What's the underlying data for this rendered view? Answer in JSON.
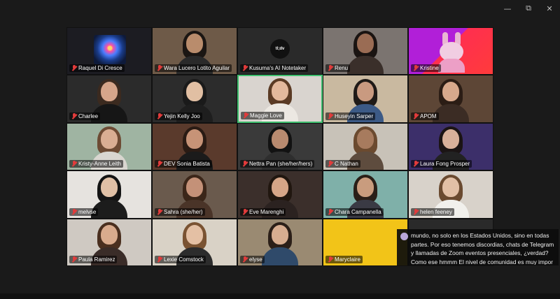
{
  "window": {
    "minimize_icon": "minimize-icon",
    "restore_icon": "restore-icon",
    "close_icon": "close-icon",
    "minimize_glyph": "—",
    "restore_glyph": "⧉",
    "close_glyph": "✕"
  },
  "participants": [
    {
      "name": "Raquel Di Cresce",
      "bg": "#1c1c22",
      "kind": "avatar-art"
    },
    {
      "name": "Wara Lucero Lotito Aguilar",
      "bg": "#6e5a48",
      "kind": "person",
      "skin": "#b98c6c",
      "hair": "#1b1613",
      "shirt": "#2a2a2a"
    },
    {
      "name": "Kusuma's AI Notetaker",
      "bg": "#2a2a2a",
      "kind": "logo",
      "logo_text": "tl;dv"
    },
    {
      "name": "Renu",
      "bg": "#7b7470",
      "kind": "person",
      "skin": "#9a6c54",
      "hair": "#1a1412",
      "shirt": "#3a2f2a"
    },
    {
      "name": "Kristine",
      "bg": "#a21fd6",
      "kind": "avatar-bunny"
    },
    {
      "name": "Charlee",
      "bg": "#2b2b2b",
      "kind": "person",
      "skin": "#d6a58a",
      "hair": "#3b2a1f",
      "shirt": "#161616"
    },
    {
      "name": "Yejin Kelly Joo",
      "bg": "#2c2c2c",
      "kind": "person",
      "skin": "#e1bfa3",
      "hair": "#1a1a1a",
      "shirt": "#1e1e1e"
    },
    {
      "name": "Maggie Love",
      "bg": "#d9d4cf",
      "kind": "person",
      "skin": "#e2b89c",
      "hair": "#5a3a24",
      "shirt": "#ece8e2",
      "active": true
    },
    {
      "name": "Huseyin Sarper",
      "bg": "#c9b9a0",
      "kind": "person",
      "skin": "#c99a80",
      "hair": "#1f1a17",
      "shirt": "#3c5a86"
    },
    {
      "name": "APOM",
      "bg": "#5d4636",
      "kind": "person",
      "skin": "#d7a98c",
      "hair": "#2b1d15",
      "shirt": "#3b2c24"
    },
    {
      "name": "Kristy-Anne Leith",
      "bg": "#9fb4a2",
      "kind": "person",
      "skin": "#d9ae93",
      "hair": "#6d4b34",
      "shirt": "#d9d6d0"
    },
    {
      "name": "DEV Sonia Batista",
      "bg": "#5a3a2c",
      "kind": "person",
      "skin": "#c79377",
      "hair": "#2a1b14",
      "shirt": "#1b1b1b"
    },
    {
      "name": "Nettra Pan (she/her/hers)",
      "bg": "#3a3a3a",
      "kind": "person",
      "skin": "#b88a6f",
      "hair": "#121212",
      "shirt": "#2e2e2e"
    },
    {
      "name": "C Nathan",
      "bg": "#c8c2b8",
      "kind": "person",
      "skin": "#a77b5e",
      "hair": "#6b4a2f",
      "shirt": "#5e4c3e"
    },
    {
      "name": "Laura Fong Prosper",
      "bg": "#3c2f6a",
      "kind": "person",
      "skin": "#d8b09a",
      "hair": "#1b1414",
      "shirt": "#222222"
    },
    {
      "name": "melvse",
      "bg": "#e6e3df",
      "kind": "person",
      "skin": "#e0c0a6",
      "hair": "#141414",
      "shirt": "#1c1c1c"
    },
    {
      "name": "Sahra (she/her)",
      "bg": "#6a5a4d",
      "kind": "person",
      "skin": "#c49178",
      "hair": "#3b2619",
      "shirt": "#4a3428"
    },
    {
      "name": "Eve Marenghi",
      "bg": "#3b2f2b",
      "kind": "person",
      "skin": "#d5a587",
      "hair": "#20160f",
      "shirt": "#2b2220"
    },
    {
      "name": "Chara Campanella",
      "bg": "#7fb0a9",
      "kind": "person",
      "skin": "#c99c7e",
      "hair": "#2a1f18",
      "shirt": "#3a3a44"
    },
    {
      "name": "helen feeney",
      "bg": "#d8d2ca",
      "kind": "person",
      "skin": "#e2c0a6",
      "hair": "#6a4a30",
      "shirt": "#f1f0ec"
    },
    {
      "name": "Paula Ramirez",
      "bg": "#cfc9c2",
      "kind": "person",
      "skin": "#d9ab8d",
      "hair": "#4a2f1f",
      "shirt": "#3a2c28"
    },
    {
      "name": "Lexie Comstock",
      "bg": "#d9d2c6",
      "kind": "person",
      "skin": "#e4c0a4",
      "hair": "#7a5332",
      "shirt": "#2c2c2c"
    },
    {
      "name": "elyse",
      "bg": "#9a8a72",
      "kind": "person",
      "skin": "#d7ad90",
      "hair": "#2b1f18",
      "shirt": "#2f4a6a"
    },
    {
      "name": "Maryclaire",
      "bg": "#f2c418",
      "kind": "empty"
    },
    {
      "name": "",
      "bg": "#2a2a2a",
      "kind": "empty-dark"
    }
  ],
  "caption": {
    "text": "mundo, no solo en los Estados Unidos, sino en todas partes. Por eso tenemos discordias, chats de Telegram y llamadas de Zoom eventos presenciales, ¿verdad? Como ese hmmm El nivel de comunidad es muy impor"
  },
  "colors": {
    "active_border": "#3fbf6f",
    "muted_mic": "#e23b3b"
  }
}
